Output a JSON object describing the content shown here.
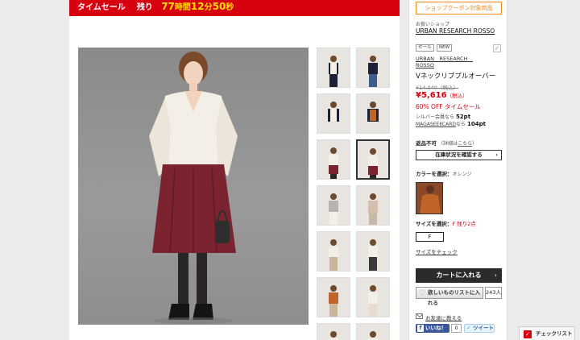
{
  "sale_banner": {
    "label": "タイムセール",
    "remaining": "残り",
    "hours": "77",
    "hours_unit": "時間",
    "minutes": "12",
    "minutes_unit": "分",
    "seconds": "50",
    "seconds_unit": "秒",
    "bg_color": "#d7000f",
    "accent_color": "#ffe000"
  },
  "coupon_button": "ショップクーポン対象商品",
  "shop": {
    "label": "お扱いショップ",
    "name": "URBAN RESEARCH ROSSO"
  },
  "tags": [
    "セール",
    "NEW"
  ],
  "product": {
    "brand": "URBAN　RESEARCH　ROSSO",
    "name": "Vネックリブプルオーバー",
    "old_price": "¥14,040（税込）",
    "price": "¥5,616",
    "price_tax": "（税込）",
    "discount": "60% OFF タイムセール",
    "silver_points_label": "シルバー会員なら",
    "silver_points": "52pt",
    "card_label": "MAGASEEKCARD",
    "card_suffix": "なら",
    "card_points": "104pt"
  },
  "return_policy": {
    "label": "返品不可",
    "detail_prefix": "（詳細は",
    "detail_link": "こちら",
    "detail_suffix": "）"
  },
  "stock_button": "在庫状況を確認する",
  "color": {
    "label": "カラーを選択：",
    "value": "オレンジ",
    "swatch_color": "#c0652a"
  },
  "size": {
    "label": "サイズを選択：",
    "value": "F 残り2点",
    "option": "F",
    "check_link": "サイズをチェック"
  },
  "cart_button": "カートに入れる",
  "wishlist": {
    "label": "欲しいものリストに入れる",
    "count": "243人"
  },
  "tell_friend": "お友達に教える",
  "facebook": {
    "label": "いいね！",
    "count": "0"
  },
  "twitter": "ツイート",
  "checklist": "チェックリスト",
  "icons": {
    "arrow": "›",
    "heart": "♡",
    "check": "✓",
    "fb": "f",
    "tw": "🐦"
  }
}
